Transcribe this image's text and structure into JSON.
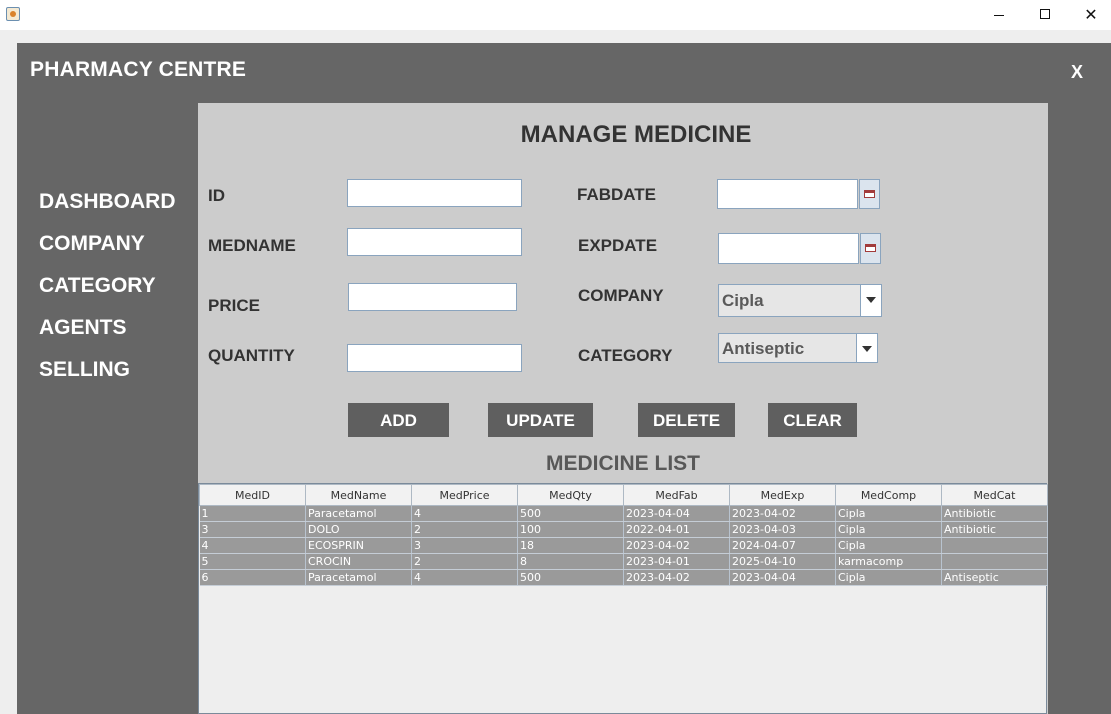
{
  "app": {
    "title": "PHARMACY CENTRE",
    "close_label": "X"
  },
  "window": {
    "close_glyph": "✕"
  },
  "nav": {
    "items": [
      "DASHBOARD",
      "COMPANY",
      "CATEGORY",
      "AGENTS",
      "SELLING"
    ]
  },
  "form": {
    "title": "MANAGE MEDICINE",
    "labels": {
      "id": "ID",
      "medname": "MEDNAME",
      "price": "PRICE",
      "quantity": "QUANTITY",
      "fabdate": "FABDATE",
      "expdate": "EXPDATE",
      "company": "COMPANY",
      "category": "CATEGORY"
    },
    "values": {
      "id": "",
      "medname": "",
      "price": "",
      "quantity": "",
      "fabdate": "",
      "expdate": ""
    },
    "company_selected": "Cipla",
    "category_selected": "Antiseptic",
    "buttons": {
      "add": "ADD",
      "update": "UPDATE",
      "delete": "DELETE",
      "clear": "CLEAR"
    }
  },
  "list": {
    "title": "MEDICINE LIST",
    "columns": [
      "MedID",
      "MedName",
      "MedPrice",
      "MedQty",
      "MedFab",
      "MedExp",
      "MedComp",
      "MedCat"
    ],
    "rows": [
      [
        "1",
        "Paracetamol",
        "4",
        "500",
        "2023-04-04",
        "2023-04-02",
        "Cipla",
        "Antibiotic"
      ],
      [
        "3",
        "DOLO",
        "2",
        "100",
        "2022-04-01",
        "2023-04-03",
        "Cipla",
        "Antibiotic"
      ],
      [
        "4",
        "ECOSPRIN",
        "3",
        "18",
        "2023-04-02",
        "2024-04-07",
        "Cipla",
        ""
      ],
      [
        "5",
        "CROCIN",
        "2",
        "8",
        "2023-04-01",
        "2025-04-10",
        "karmacomp",
        ""
      ],
      [
        "6",
        "Paracetamol",
        "4",
        "500",
        "2023-04-02",
        "2023-04-04",
        "Cipla",
        "Antiseptic"
      ]
    ]
  },
  "colors": {
    "frame": "#666666",
    "panel": "#cccccc",
    "button": "#5f5f5f",
    "row": "#9a9a9a"
  },
  "icons": {
    "app": "java-cup-icon",
    "date_picker": "calendar-icon",
    "dropdown": "chevron-down-icon"
  }
}
